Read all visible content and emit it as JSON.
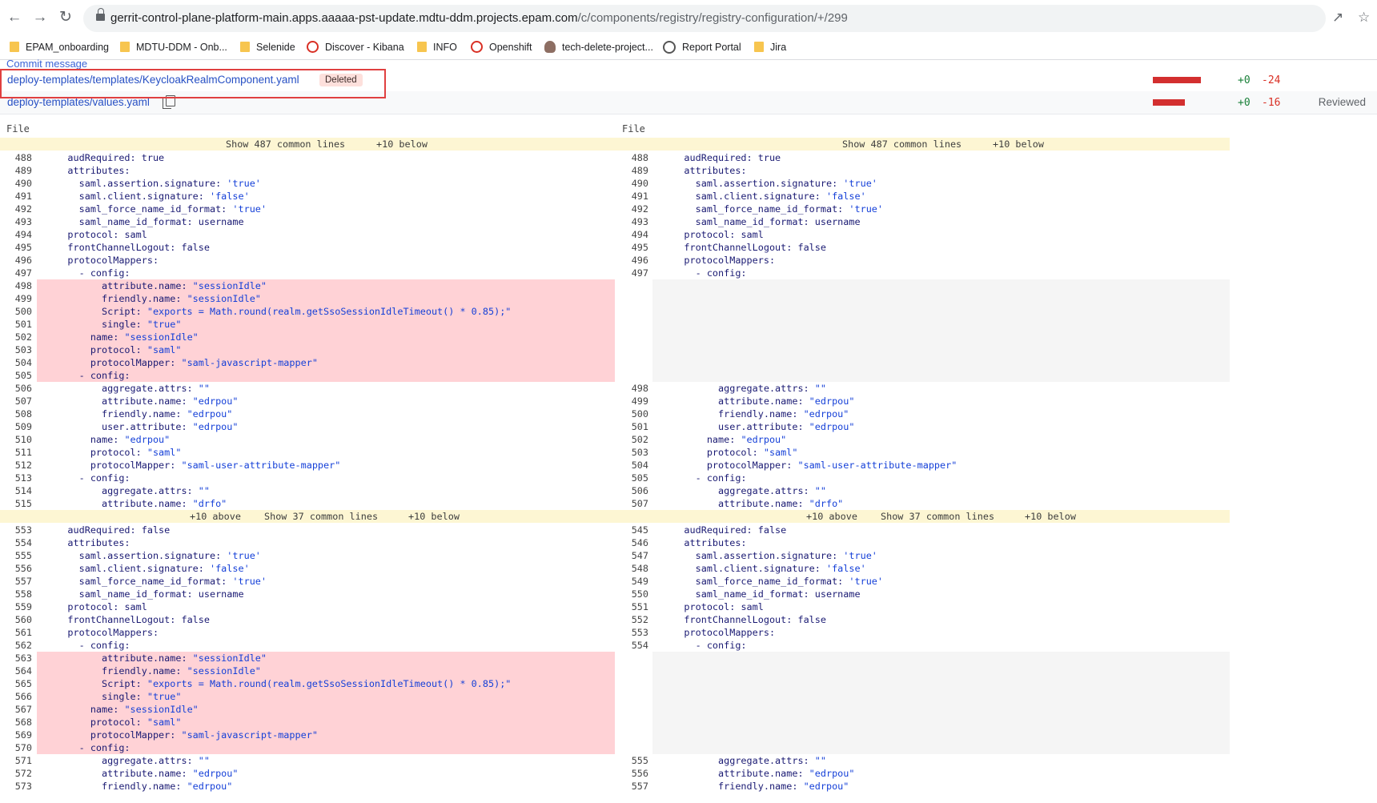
{
  "browser": {
    "url_host": "gerrit-control-plane-platform-main.apps.aaaaa-pst-update.mdtu-ddm.projects.epam.com",
    "url_path": "/c/components/registry/registry-configuration/+/299",
    "bookmarks": [
      {
        "label": "EPAM_onboarding",
        "icon": "folder-icon"
      },
      {
        "label": "MDTU-DDM - Onb...",
        "icon": "folder-icon"
      },
      {
        "label": "Selenide",
        "icon": "folder-icon"
      },
      {
        "label": "Discover - Kibana",
        "icon": "opera-icon"
      },
      {
        "label": "INFO",
        "icon": "folder-icon"
      },
      {
        "label": "Openshift",
        "icon": "opera-icon"
      },
      {
        "label": "tech-delete-project...",
        "icon": "avatar-icon"
      },
      {
        "label": "Report Portal",
        "icon": "gear-icon"
      },
      {
        "label": "Jira",
        "icon": "folder-icon"
      }
    ]
  },
  "commit_message_label": "Commit message",
  "files": [
    {
      "name": "deploy-templates/templates/KeycloakRealmComponent.yaml",
      "badge": "Deleted",
      "added": "+0",
      "removed": "-24",
      "reviewed": ""
    },
    {
      "name": "deploy-templates/values.yaml",
      "badge": "",
      "added": "+0",
      "removed": "-16",
      "reviewed": "Reviewed"
    }
  ],
  "diff": {
    "file_label": "File",
    "gap1": {
      "show": "Show 487 common lines",
      "below": "+10 below"
    },
    "gap2": {
      "above": "+10 above",
      "show": "Show 37 common lines",
      "below": "+10 below"
    },
    "block1": [
      {
        "l": "488",
        "r": "488",
        "code": "    audRequired: true"
      },
      {
        "l": "489",
        "r": "489",
        "code": "    attributes:"
      },
      {
        "l": "490",
        "r": "490",
        "code": "      saml.assertion.signature: 'true'"
      },
      {
        "l": "491",
        "r": "491",
        "code": "      saml.client.signature: 'false'"
      },
      {
        "l": "492",
        "r": "492",
        "code": "      saml_force_name_id_format: 'true'"
      },
      {
        "l": "493",
        "r": "493",
        "code": "      saml_name_id_format: username"
      },
      {
        "l": "494",
        "r": "494",
        "code": "    protocol: saml"
      },
      {
        "l": "495",
        "r": "495",
        "code": "    frontChannelLogout: false"
      },
      {
        "l": "496",
        "r": "496",
        "code": "    protocolMappers:"
      },
      {
        "l": "497",
        "r": "497",
        "code": "      - config:"
      },
      {
        "l": "498",
        "r": "",
        "del": true,
        "code": "          attribute.name: \"sessionIdle\""
      },
      {
        "l": "499",
        "r": "",
        "del": true,
        "code": "          friendly.name: \"sessionIdle\""
      },
      {
        "l": "500",
        "r": "",
        "del": true,
        "code": "          Script: \"exports = Math.round(realm.getSsoSessionIdleTimeout() * 0.85);\""
      },
      {
        "l": "501",
        "r": "",
        "del": true,
        "code": "          single: \"true\""
      },
      {
        "l": "502",
        "r": "",
        "del": true,
        "code": "        name: \"sessionIdle\""
      },
      {
        "l": "503",
        "r": "",
        "del": true,
        "code": "        protocol: \"saml\""
      },
      {
        "l": "504",
        "r": "",
        "del": true,
        "code": "        protocolMapper: \"saml-javascript-mapper\""
      },
      {
        "l": "505",
        "r": "",
        "del": true,
        "code": "      - config:"
      },
      {
        "l": "506",
        "r": "498",
        "code": "          aggregate.attrs: \"\""
      },
      {
        "l": "507",
        "r": "499",
        "code": "          attribute.name: \"edrpou\""
      },
      {
        "l": "508",
        "r": "500",
        "code": "          friendly.name: \"edrpou\""
      },
      {
        "l": "509",
        "r": "501",
        "code": "          user.attribute: \"edrpou\""
      },
      {
        "l": "510",
        "r": "502",
        "code": "        name: \"edrpou\""
      },
      {
        "l": "511",
        "r": "503",
        "code": "        protocol: \"saml\""
      },
      {
        "l": "512",
        "r": "504",
        "code": "        protocolMapper: \"saml-user-attribute-mapper\""
      },
      {
        "l": "513",
        "r": "505",
        "code": "      - config:"
      },
      {
        "l": "514",
        "r": "506",
        "code": "          aggregate.attrs: \"\""
      },
      {
        "l": "515",
        "r": "507",
        "code": "          attribute.name: \"drfo\""
      }
    ],
    "block2": [
      {
        "l": "553",
        "r": "545",
        "code": "    audRequired: false"
      },
      {
        "l": "554",
        "r": "546",
        "code": "    attributes:"
      },
      {
        "l": "555",
        "r": "547",
        "code": "      saml.assertion.signature: 'true'"
      },
      {
        "l": "556",
        "r": "548",
        "code": "      saml.client.signature: 'false'"
      },
      {
        "l": "557",
        "r": "549",
        "code": "      saml_force_name_id_format: 'true'"
      },
      {
        "l": "558",
        "r": "550",
        "code": "      saml_name_id_format: username"
      },
      {
        "l": "559",
        "r": "551",
        "code": "    protocol: saml"
      },
      {
        "l": "560",
        "r": "552",
        "code": "    frontChannelLogout: false"
      },
      {
        "l": "561",
        "r": "553",
        "code": "    protocolMappers:"
      },
      {
        "l": "562",
        "r": "554",
        "code": "      - config:"
      },
      {
        "l": "563",
        "r": "",
        "del": true,
        "code": "          attribute.name: \"sessionIdle\""
      },
      {
        "l": "564",
        "r": "",
        "del": true,
        "code": "          friendly.name: \"sessionIdle\""
      },
      {
        "l": "565",
        "r": "",
        "del": true,
        "code": "          Script: \"exports = Math.round(realm.getSsoSessionIdleTimeout() * 0.85);\""
      },
      {
        "l": "566",
        "r": "",
        "del": true,
        "code": "          single: \"true\""
      },
      {
        "l": "567",
        "r": "",
        "del": true,
        "code": "        name: \"sessionIdle\""
      },
      {
        "l": "568",
        "r": "",
        "del": true,
        "code": "        protocol: \"saml\""
      },
      {
        "l": "569",
        "r": "",
        "del": true,
        "code": "        protocolMapper: \"saml-javascript-mapper\""
      },
      {
        "l": "570",
        "r": "",
        "del": true,
        "code": "      - config:"
      },
      {
        "l": "571",
        "r": "555",
        "code": "          aggregate.attrs: \"\""
      },
      {
        "l": "572",
        "r": "556",
        "code": "          attribute.name: \"edrpou\""
      },
      {
        "l": "573",
        "r": "557",
        "code": "          friendly.name: \"edrpou\""
      }
    ]
  }
}
